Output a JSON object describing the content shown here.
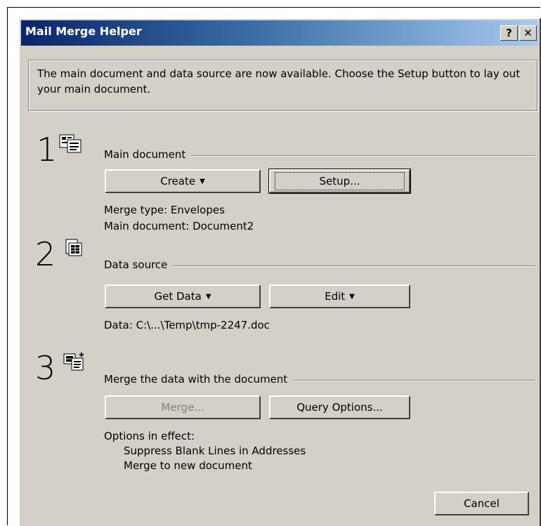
{
  "window": {
    "title": "Mail Merge Helper",
    "help_label": "?",
    "close_label": "✕"
  },
  "info": {
    "text": "The main document and data source are now available. Choose the Setup button to lay out your main document."
  },
  "step1": {
    "number": "1",
    "icon": "document-template-icon",
    "group_label": "Main document",
    "create_label": "Create",
    "setup_label": "Setup...",
    "merge_type": "Merge type: Envelopes",
    "main_document": "Main document: Document2"
  },
  "step2": {
    "number": "2",
    "icon": "data-source-icon",
    "group_label": "Data source",
    "get_data_label": "Get Data",
    "edit_label": "Edit",
    "data": "Data: C:\\...\\Temp\\tmp-2247.doc"
  },
  "step3": {
    "number": "3",
    "icon": "merge-document-icon",
    "group_label": "Merge the data with the document",
    "merge_label": "Merge...",
    "query_label": "Query Options...",
    "options_heading": "Options in effect:",
    "option1": "Suppress Blank Lines in Addresses",
    "option2": "Merge to new document"
  },
  "footer": {
    "cancel_label": "Cancel"
  }
}
